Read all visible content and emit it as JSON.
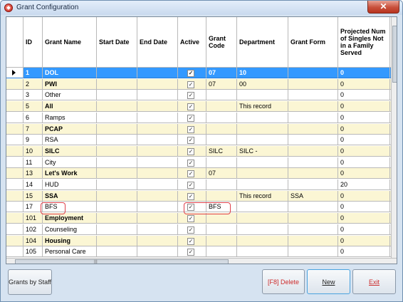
{
  "window": {
    "title": "Grant Configuration",
    "close_label": "✕"
  },
  "grid": {
    "columns": {
      "id": "ID",
      "grant_name": "Grant Name",
      "start_date": "Start Date",
      "end_date": "End Date",
      "active": "Active",
      "grant_code": "Grant Code",
      "department": "Department",
      "grant_form": "Grant Form",
      "projected": "Projected Num of Singles Not in a Family Served"
    },
    "rows": [
      {
        "id": "1",
        "name": "DOL",
        "active": "✓",
        "code": "07",
        "department": "10",
        "form": "",
        "projected": "0",
        "selected": true
      },
      {
        "id": "2",
        "name": "PWI",
        "active": "✓",
        "code": "07",
        "department": "00",
        "form": "",
        "projected": "0"
      },
      {
        "id": "3",
        "name": "Other",
        "active": "✓",
        "code": "",
        "department": "",
        "form": "",
        "projected": "0"
      },
      {
        "id": "5",
        "name": "All",
        "active": "✓",
        "code": "",
        "department": "This record",
        "form": "",
        "projected": "0"
      },
      {
        "id": "6",
        "name": "Ramps",
        "active": "✓",
        "code": "",
        "department": "",
        "form": "",
        "projected": "0"
      },
      {
        "id": "7",
        "name": "PCAP",
        "active": "✓",
        "code": "",
        "department": "",
        "form": "",
        "projected": "0"
      },
      {
        "id": "9",
        "name": "RSA",
        "active": "✓",
        "code": "",
        "department": "",
        "form": "",
        "projected": "0"
      },
      {
        "id": "10",
        "name": "SILC",
        "active": "✓",
        "code": "SILC",
        "department": "SILC -",
        "form": "",
        "projected": "0"
      },
      {
        "id": "11",
        "name": "City",
        "active": "✓",
        "code": "",
        "department": "",
        "form": "",
        "projected": "0"
      },
      {
        "id": "13",
        "name": "Let's Work",
        "active": "✓",
        "code": "07",
        "department": "",
        "form": "",
        "projected": "0"
      },
      {
        "id": "14",
        "name": "HUD",
        "active": "✓",
        "code": "",
        "department": "",
        "form": "",
        "projected": "20"
      },
      {
        "id": "15",
        "name": "SSA",
        "active": "✓",
        "code": "",
        "department": "This record",
        "form": "SSA",
        "projected": "0"
      },
      {
        "id": "17",
        "name": "BFS",
        "active": "✓",
        "code": "BFS",
        "department": "",
        "form": "",
        "projected": "0"
      },
      {
        "id": "101",
        "name": "Employment",
        "active": "✓",
        "code": "",
        "department": "",
        "form": "",
        "projected": "0"
      },
      {
        "id": "102",
        "name": "Counseling",
        "active": "✓",
        "code": "",
        "department": "",
        "form": "",
        "projected": "0"
      },
      {
        "id": "104",
        "name": "Housing",
        "active": "✓",
        "code": "",
        "department": "",
        "form": "",
        "projected": "0"
      },
      {
        "id": "105",
        "name": "Personal Care",
        "active": "✓",
        "code": "",
        "department": "",
        "form": "",
        "projected": "0"
      }
    ],
    "hscroll_grip": "|||"
  },
  "buttons": {
    "grants_by_staff": "Grants by Staff",
    "delete": "[F8] Delete",
    "new": "New",
    "exit": "Exit"
  }
}
